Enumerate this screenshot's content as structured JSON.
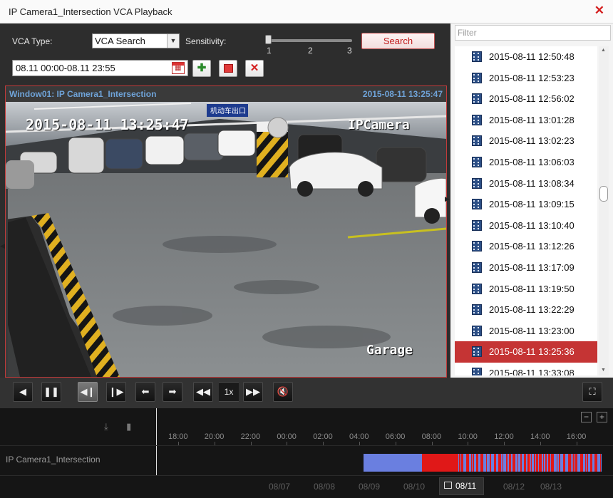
{
  "window": {
    "title": "IP Camera1_Intersection VCA Playback",
    "close_icon": "close-icon"
  },
  "search": {
    "vca_type_label": "VCA Type:",
    "vca_type_value": "VCA Search",
    "sensitivity_label": "Sensitivity:",
    "sensitivity_ticks": [
      "1",
      "2",
      "3"
    ],
    "sensitivity_value": 1,
    "search_button": "Search",
    "date_range": "08.11 00:00-08.11 23:55"
  },
  "video": {
    "window_title": "Window01: IP Camera1_Intersection",
    "window_time": "2015-08-11 13:25:47",
    "osd_time": "2015-08-11 13:25:47",
    "osd_name": "IPCamera",
    "osd_location": "Garage",
    "sign_text": "机动车出口"
  },
  "playback": {
    "speed": "1x"
  },
  "filter": {
    "placeholder": "Filter"
  },
  "files": [
    "2015-08-11 12:50:48",
    "2015-08-11 12:53:23",
    "2015-08-11 12:56:02",
    "2015-08-11 13:01:28",
    "2015-08-11 13:02:23",
    "2015-08-11 13:06:03",
    "2015-08-11 13:08:34",
    "2015-08-11 13:09:15",
    "2015-08-11 13:10:40",
    "2015-08-11 13:12:26",
    "2015-08-11 13:17:09",
    "2015-08-11 13:19:50",
    "2015-08-11 13:22:29",
    "2015-08-11 13:23:00",
    "2015-08-11 13:25:36",
    "2015-08-11 13:33:08"
  ],
  "selected_file_index": 14,
  "timeline": {
    "camera": "IP Camera1_Intersection",
    "hours": [
      "18:00",
      "20:00",
      "22:00",
      "00:00",
      "02:00",
      "04:00",
      "06:00",
      "08:00",
      "10:00",
      "12:00",
      "14:00",
      "16:00"
    ],
    "dates": [
      "08/07",
      "08/08",
      "08/09",
      "08/10",
      "08/11",
      "08/12",
      "08/13"
    ],
    "selected_date": "08/11",
    "recording_colors": {
      "normal": "#6a7fe0",
      "event": "#e01818"
    }
  }
}
